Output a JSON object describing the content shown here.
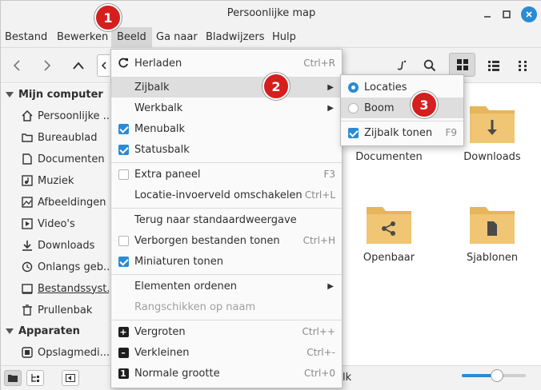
{
  "window": {
    "title": "Persoonlijke map"
  },
  "menubar": [
    "Bestand",
    "Bewerken",
    "Beeld",
    "Ga naar",
    "Bladwijzers",
    "Hulp"
  ],
  "sidebar": {
    "section_computer": "Mijn computer",
    "computer_items": [
      {
        "label": "Persoonlijke ...",
        "icon": "home-icon"
      },
      {
        "label": "Bureaublad",
        "icon": "folder-icon"
      },
      {
        "label": "Documenten",
        "icon": "document-icon"
      },
      {
        "label": "Muziek",
        "icon": "music-icon"
      },
      {
        "label": "Afbeeldingen",
        "icon": "image-icon"
      },
      {
        "label": "Video's",
        "icon": "video-icon"
      },
      {
        "label": "Downloads",
        "icon": "download-icon"
      },
      {
        "label": "Onlangs geb...",
        "icon": "history-icon"
      },
      {
        "label": "Bestandssyst...",
        "icon": "drive-icon"
      },
      {
        "label": "Prullenbak",
        "icon": "trash-icon"
      }
    ],
    "section_devices": "Apparaten",
    "device_items": [
      {
        "label": "Opslagmedi...",
        "icon": "drive-icon"
      }
    ]
  },
  "content": {
    "folders": [
      {
        "label": "Documenten",
        "icon": "document-folder-icon"
      },
      {
        "label": "Downloads",
        "icon": "download-folder-icon"
      },
      {
        "label": "Openbaar",
        "icon": "share-folder-icon"
      },
      {
        "label": "Sjablonen",
        "icon": "template-folder-icon"
      }
    ]
  },
  "view_menu": {
    "items": [
      {
        "label": "Herladen",
        "accel": "Ctrl+R",
        "icon": "reload-icon"
      },
      {
        "label": "Zijbalk",
        "submenu": true
      },
      {
        "label": "Werkbalk",
        "submenu": true
      },
      {
        "label": "Menubalk",
        "checked": true
      },
      {
        "label": "Statusbalk",
        "checked": true
      },
      {
        "label": "Extra paneel",
        "accel": "F3",
        "checked": false
      },
      {
        "label": "Locatie-invoerveld omschakelen",
        "accel": "Ctrl+L"
      },
      {
        "label": "Terug naar standaardweergave"
      },
      {
        "label": "Verborgen bestanden tonen",
        "accel": "Ctrl+H",
        "checked": false
      },
      {
        "label": "Miniaturen tonen",
        "checked": true
      },
      {
        "label": "Elementen ordenen",
        "submenu": true
      },
      {
        "label": "Rangschikken op naam",
        "disabled": true
      },
      {
        "label": "Vergroten",
        "accel": "Ctrl++",
        "icon": "zoom-in-icon"
      },
      {
        "label": "Verkleinen",
        "accel": "Ctrl+-",
        "icon": "zoom-out-icon"
      },
      {
        "label": "Normale grootte",
        "accel": "Ctrl+0",
        "icon": "zoom-normal-icon"
      }
    ]
  },
  "sidebar_submenu": {
    "items": [
      {
        "label": "Locaties",
        "selected": true
      },
      {
        "label": "Boom",
        "selected": false
      },
      {
        "label": "Zijbalk tonen",
        "accel": "F9",
        "checked": true
      }
    ]
  },
  "statusbar": {
    "partial_text": "lk",
    "zoom_level": 0.55
  },
  "badges": [
    "1",
    "2",
    "3"
  ],
  "colors": {
    "accent": "#2b8ad6",
    "badge": "#d51e1e",
    "folder": "#f0c574"
  }
}
